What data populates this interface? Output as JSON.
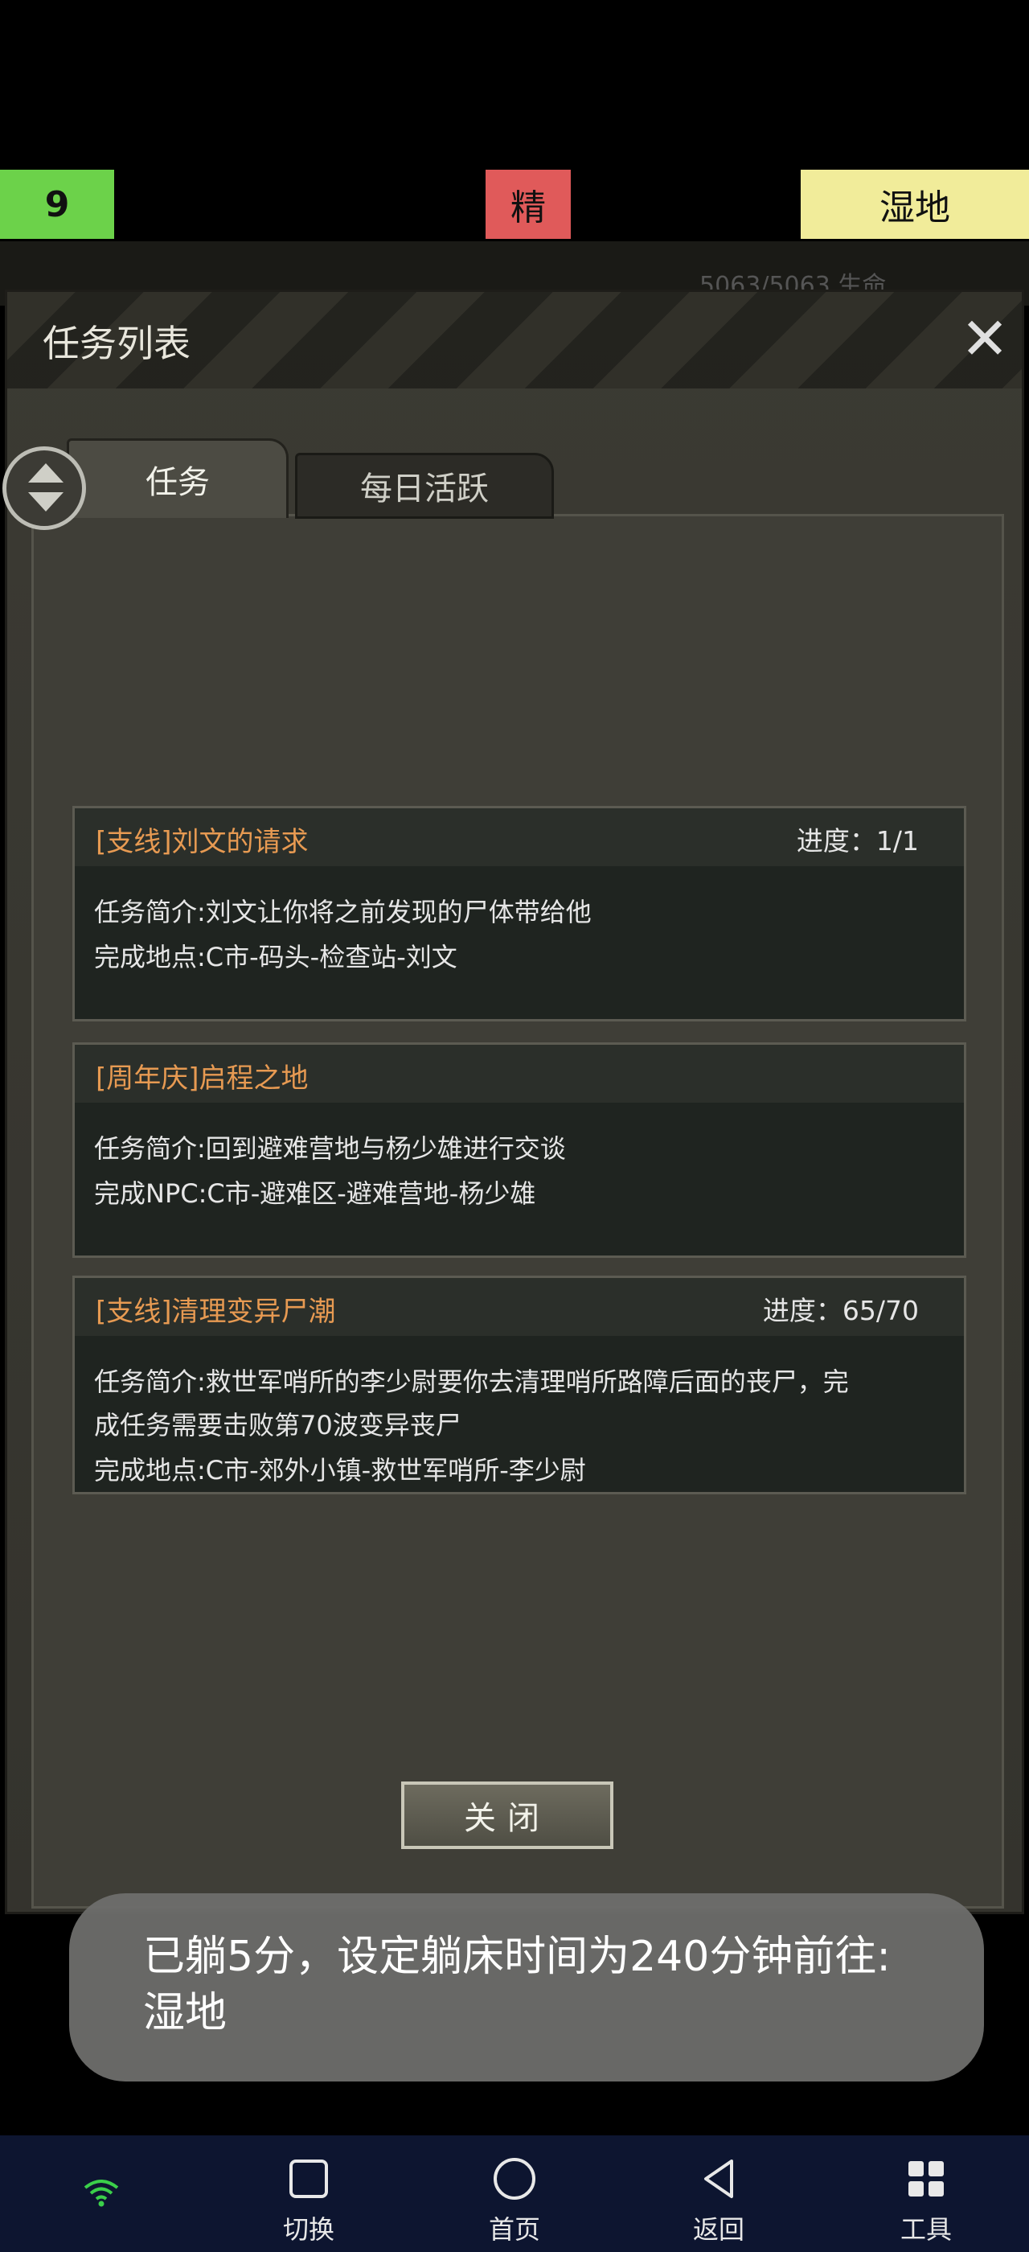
{
  "status": {
    "level": "9",
    "elite_label": "精",
    "terrain": "湿地",
    "bg_stat": "5063/5063    生命"
  },
  "dialog": {
    "title": "任务列表",
    "tabs": [
      {
        "label": "任务"
      },
      {
        "label": "每日活跃"
      }
    ],
    "tasks": [
      {
        "title": "[支线]刘文的请求",
        "progress": "进度：1/1",
        "lines": [
          "任务简介:刘文让你将之前发现的尸体带给他",
          "完成地点:C市-码头-检查站-刘文"
        ]
      },
      {
        "title": "[周年庆]启程之地",
        "progress": "",
        "lines": [
          "任务简介:回到避难营地与杨少雄进行交谈",
          "完成NPC:C市-避难区-避难营地-杨少雄"
        ]
      },
      {
        "title": "[支线]清理变异尸潮",
        "progress": "进度：65/70",
        "lines": [
          "任务简介:救世军哨所的李少尉要你去清理哨所路障后面的丧尸，完",
          "成任务需要击败第70波变异丧尸",
          "完成地点:C市-郊外小镇-救世军哨所-李少尉"
        ]
      }
    ],
    "close_button": "关闭"
  },
  "toast": {
    "text": "已躺5分，设定躺床时间为240分钟前往:湿地"
  },
  "navbar": {
    "switch": "切换",
    "home": "首页",
    "back": "返回",
    "tools": "工具"
  }
}
